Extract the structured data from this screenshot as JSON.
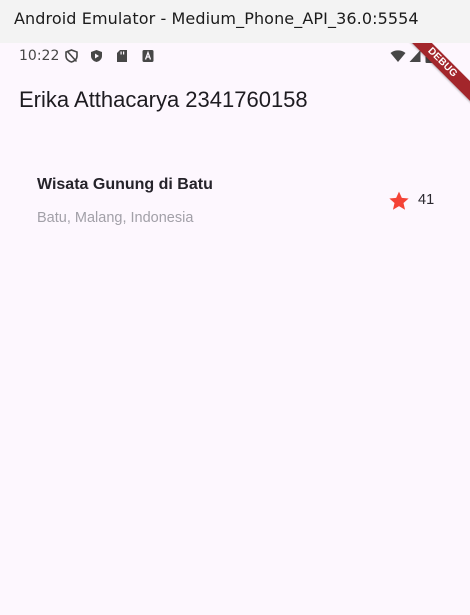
{
  "window": {
    "title": "Android Emulator - Medium_Phone_API_36.0:5554"
  },
  "status_bar": {
    "time": "10:22",
    "icons": [
      "shield-outline-icon",
      "shield-play-icon",
      "sd-card-icon",
      "font-badge-icon",
      "wifi-icon",
      "cell-signal-icon",
      "battery-icon"
    ]
  },
  "debug_banner": {
    "label": "DEBUG"
  },
  "app_bar": {
    "title": "Erika Atthacarya 2341760158"
  },
  "place": {
    "name": "Wisata Gunung di Batu",
    "location": "Batu, Malang, Indonesia",
    "star_icon": "star-icon",
    "star_color": "#f44336",
    "rating": "41"
  },
  "colors": {
    "background": "#fdf7fe",
    "titlebar": "#f3f3f3",
    "debug_banner": "#a3262b"
  }
}
